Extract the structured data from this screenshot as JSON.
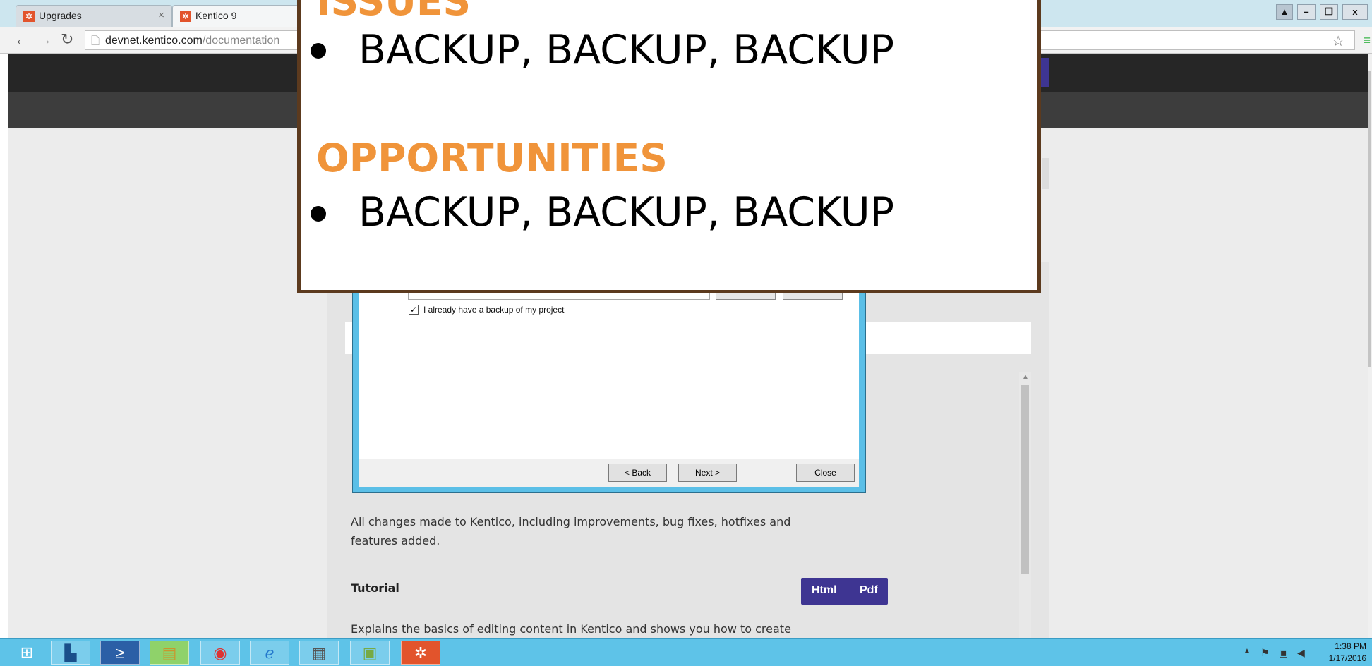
{
  "browser": {
    "tabs": [
      {
        "label": "Upgrades",
        "favicon": "kentico-icon",
        "active": false
      },
      {
        "label": "Kentico 9",
        "favicon": "kentico-icon",
        "active": true
      }
    ],
    "url_host": "devnet.kentico.com",
    "url_path": "/documentation",
    "window_buttons": {
      "minimize": "–",
      "restore": "❐",
      "close": "x"
    }
  },
  "site": {
    "changes_description": "All changes made to Kentico, including improvements, bug fixes, hotfixes and features added.",
    "tutorial_label": "Tutorial",
    "tutorial_formats": [
      "Html",
      "Pdf"
    ],
    "tutorial_description": "Explains the basics of editing content in Kentico and shows you how to create"
  },
  "dialog": {
    "already_backup_label": "I already have a backup of my project",
    "already_backup_checked": true,
    "back_label": "< Back",
    "next_label": "Next >",
    "close_label": "Close"
  },
  "slide": {
    "issues_heading": "ISSUES",
    "issues_bullet": "BACKUP, BACKUP, BACKUP",
    "opportunities_heading": "OPPORTUNITIES",
    "opportunities_bullet": "BACKUP, BACKUP, BACKUP",
    "heading_color": "#f0943a",
    "border_color": "#5c3a1e"
  },
  "taskbar": {
    "items": [
      "start-icon",
      "server-manager-icon",
      "powershell-icon",
      "file-explorer-icon",
      "chrome-icon",
      "internet-explorer-icon",
      "installer-icon",
      "app-icon",
      "kentico-icon"
    ],
    "time": "1:38 PM",
    "date": "1/17/2016"
  },
  "colors": {
    "accent_purple": "#3e3592",
    "taskbar": "#5ec3e8"
  }
}
